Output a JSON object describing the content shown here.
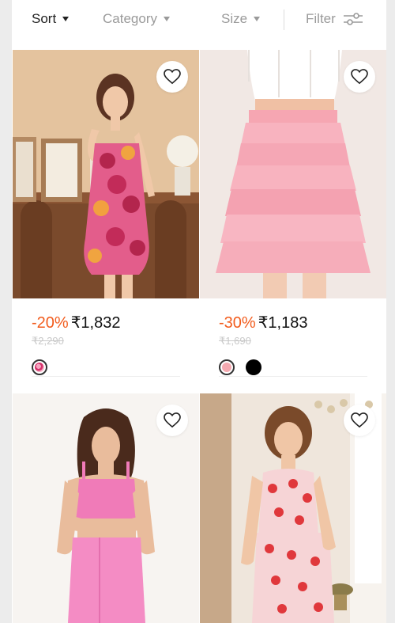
{
  "toolbar": {
    "sort_label": "Sort",
    "category_label": "Category",
    "size_label": "Size",
    "filter_label": "Filter"
  },
  "products": [
    {
      "discount": "-20%",
      "price": "₹1,832",
      "original_price": "₹2,290",
      "swatches": [
        "#e06b8f"
      ],
      "image": "floral strapless mini dress"
    },
    {
      "discount": "-30%",
      "price": "₹1,183",
      "original_price": "₹1,690",
      "swatches": [
        "#f4a9b0",
        "#000000"
      ],
      "image": "pink tiered tulle skirt"
    },
    {
      "image": "pink leather crop top and skirt set"
    },
    {
      "image": "red floral cutout romper"
    }
  ],
  "colors": {
    "discount": "#f25c1d",
    "text": "#111111",
    "muted": "#9a9a9a"
  }
}
